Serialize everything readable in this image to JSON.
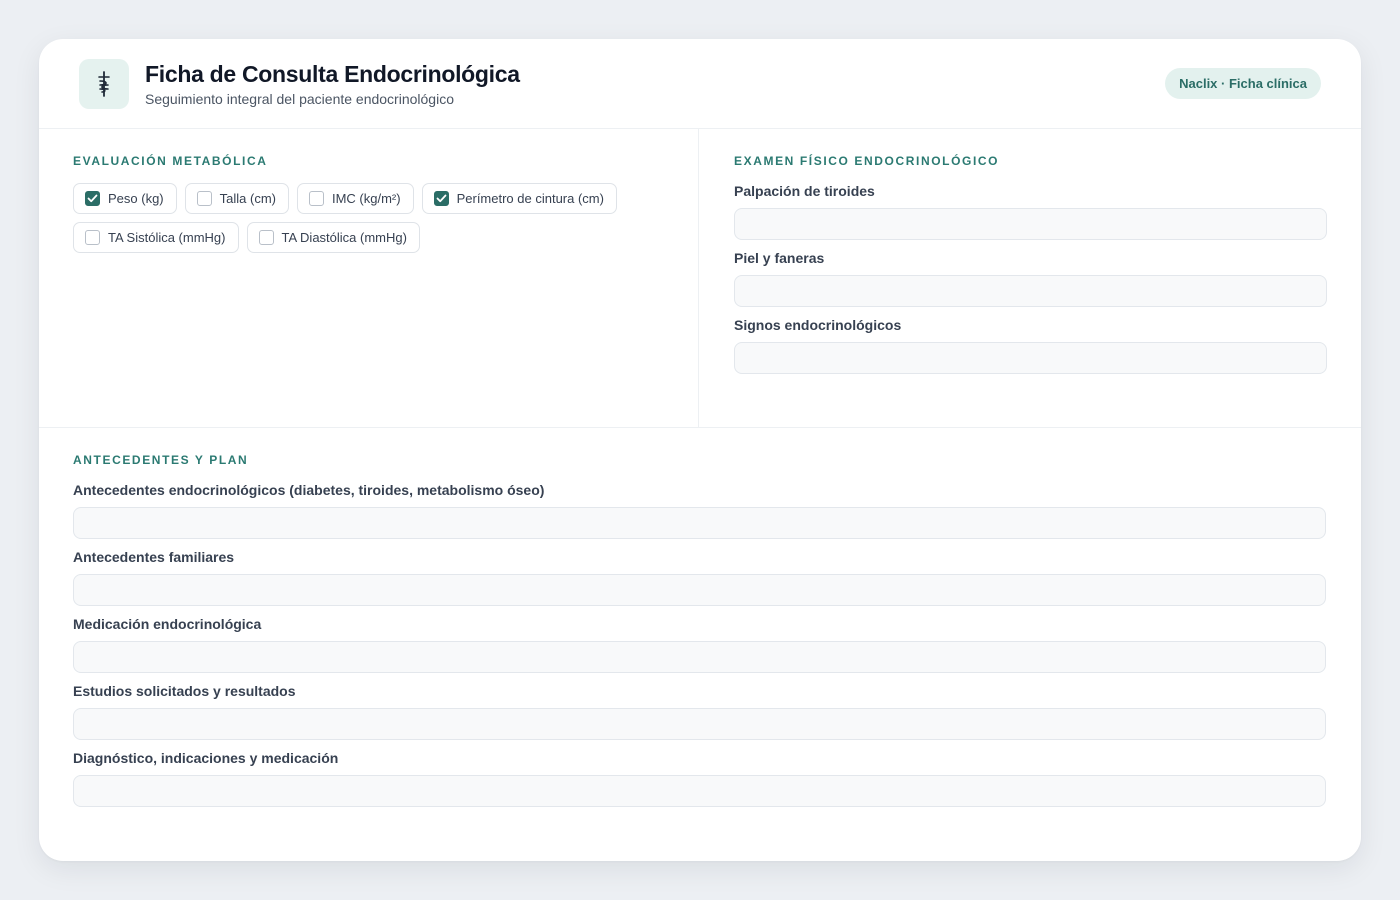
{
  "header": {
    "title": "Ficha de Consulta Endocrinológica",
    "subtitle": "Seguimiento integral del paciente endocrinológico",
    "badge": "Naclix · Ficha clínica",
    "logo_icon": "caduceus-icon"
  },
  "metabolic": {
    "title": "EVALUACIÓN METABÓLICA",
    "items": [
      {
        "label": "Peso (kg)",
        "checked": true
      },
      {
        "label": "Talla (cm)",
        "checked": false
      },
      {
        "label": "IMC (kg/m²)",
        "checked": false
      },
      {
        "label": "Perímetro de cintura (cm)",
        "checked": true
      },
      {
        "label": "TA Sistólica (mmHg)",
        "checked": false
      },
      {
        "label": "TA Diastólica (mmHg)",
        "checked": false
      }
    ]
  },
  "physical": {
    "title": "EXAMEN FÍSICO ENDOCRINOLÓGICO",
    "fields": [
      {
        "label": "Palpación de tiroides",
        "value": ""
      },
      {
        "label": "Piel y faneras",
        "value": ""
      },
      {
        "label": "Signos endocrinológicos",
        "value": ""
      }
    ]
  },
  "history": {
    "title": "ANTECEDENTES Y PLAN",
    "fields": [
      {
        "label": "Antecedentes endocrinológicos (diabetes, tiroides, metabolismo óseo)",
        "value": ""
      },
      {
        "label": "Antecedentes familiares",
        "value": ""
      },
      {
        "label": "Medicación endocrinológica",
        "value": ""
      },
      {
        "label": "Estudios solicitados y resultados",
        "value": ""
      },
      {
        "label": "Diagnóstico, indicaciones y medicación",
        "value": ""
      }
    ]
  },
  "colors": {
    "accent": "#2b6d66",
    "section_title": "#2b7a72",
    "background": "#eceff3"
  }
}
